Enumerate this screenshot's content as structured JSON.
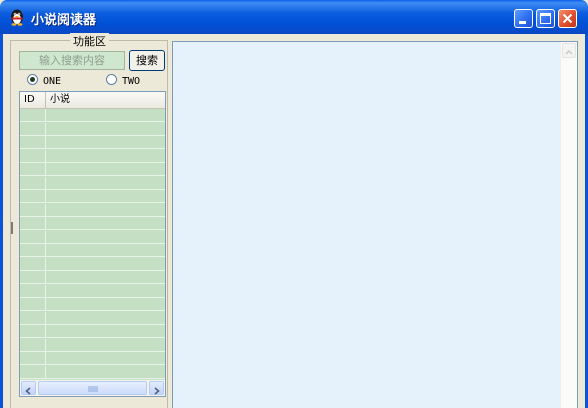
{
  "window": {
    "title": "小说阅读器",
    "icon": "penguin-icon",
    "controls": [
      "minimize-icon",
      "maximize-icon",
      "close-icon"
    ]
  },
  "function_area": {
    "group_label": "功能区",
    "search": {
      "placeholder": "输入搜索内容",
      "button_label": "搜索"
    },
    "options": [
      {
        "label": "ONE",
        "checked": true
      },
      {
        "label": "TWO",
        "checked": false
      }
    ],
    "table": {
      "columns": [
        "ID",
        "小说"
      ],
      "rows": []
    }
  },
  "colors": {
    "titlebar": "#0054e3",
    "list_bg": "#c4dfc4",
    "content_bg": "#e6f2fb",
    "close_button": "#e0502c"
  }
}
